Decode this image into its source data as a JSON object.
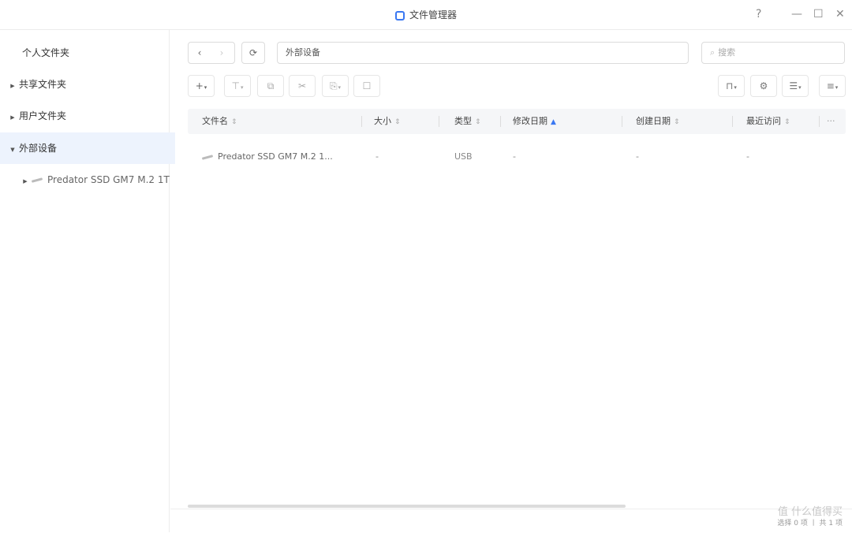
{
  "window": {
    "title": "文件管理器",
    "help": "?",
    "minimize": "—",
    "maximize": "☐",
    "close": "✕"
  },
  "sidebar": {
    "items": [
      {
        "label": "个人文件夹",
        "caret": ""
      },
      {
        "label": "共享文件夹",
        "caret": "▶"
      },
      {
        "label": "用户文件夹",
        "caret": "▶"
      },
      {
        "label": "外部设备",
        "caret": "▼",
        "active": true
      },
      {
        "label": "Predator SSD GM7 M.2 1T",
        "caret": "▶"
      }
    ]
  },
  "toolbar": {
    "back": "‹",
    "forward": "›",
    "refresh": "⟳",
    "path": "外部设备",
    "search_placeholder": "搜索",
    "search_icon": "⌕",
    "actions": [
      {
        "name": "new-button",
        "glyph": "+"
      },
      {
        "name": "upload-button",
        "glyph": "⊤"
      },
      {
        "name": "copy-button",
        "glyph": "⧉"
      },
      {
        "name": "cut-button",
        "glyph": "✂"
      },
      {
        "name": "move-button",
        "glyph": "⎘"
      },
      {
        "name": "comment-button",
        "glyph": "☐"
      }
    ],
    "right_actions": [
      {
        "name": "lock-button",
        "glyph": "⊓"
      },
      {
        "name": "settings-button",
        "glyph": "⚙"
      },
      {
        "name": "view-mode-button",
        "glyph": "☰"
      },
      {
        "name": "sort-button",
        "glyph": "≡"
      }
    ]
  },
  "table": {
    "columns": [
      "文件名",
      "大小",
      "类型",
      "修改日期",
      "创建日期",
      "最近访问"
    ],
    "more": "···",
    "rows": [
      {
        "name": "Predator SSD GM7 M.2 1...",
        "size": "-",
        "type": "USB",
        "modified": "-",
        "created": "-",
        "accessed": "-"
      }
    ]
  },
  "footer": {
    "status": "选择 0 项 丨 共 1 项"
  },
  "watermark": "值 什么值得买",
  "colors": {
    "accent": "#3a78f2",
    "active_bg": "#edf3fd"
  }
}
